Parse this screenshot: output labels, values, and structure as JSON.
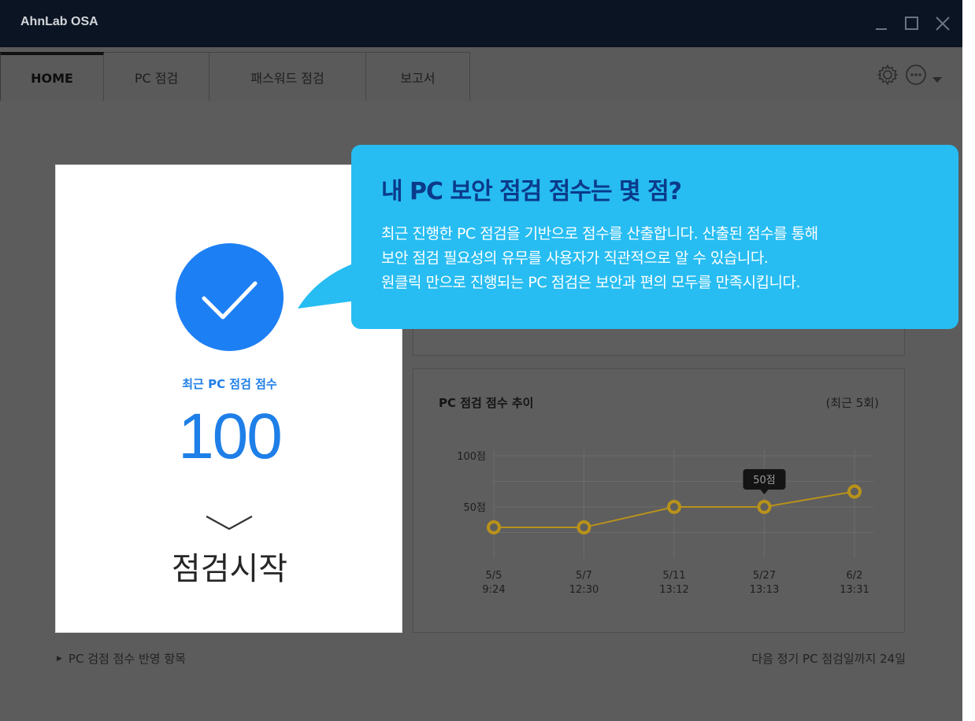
{
  "app": {
    "title": "AhnLab OSA"
  },
  "window_controls": {
    "minimize": "minimize-icon",
    "maximize": "maximize-icon",
    "close": "close-icon"
  },
  "tabs": [
    {
      "label": "HOME",
      "active": true
    },
    {
      "label": "PC 점검",
      "active": false
    },
    {
      "label": "패스워드 점검",
      "active": false
    },
    {
      "label": "보고서",
      "active": false
    }
  ],
  "toolbar_icons": [
    "gear-icon",
    "more-icon",
    "caret-down-icon"
  ],
  "score_card": {
    "label": "최근 PC 점검 점수",
    "value": "100",
    "start_label": "점검시작",
    "accent": "#1d7ff4"
  },
  "trend_panel": {
    "title": "PC 점검 점수 추이",
    "subtitle": "(최근 5회)"
  },
  "chart_data": {
    "type": "line",
    "title": "PC 점검 점수 추이",
    "subtitle": "(최근 5회)",
    "y_tick_labels": [
      "100점",
      "50점"
    ],
    "ylim": [
      0,
      100
    ],
    "categories": [
      "5/5 9:24",
      "5/7 12:30",
      "5/11 13:12",
      "5/27 13:13",
      "6/2 13:31"
    ],
    "x_tick_lines": [
      [
        "5/5",
        "9:24"
      ],
      [
        "5/7",
        "12:30"
      ],
      [
        "5/11",
        "13:12"
      ],
      [
        "5/27",
        "13:13"
      ],
      [
        "6/2",
        "13:31"
      ]
    ],
    "values": [
      30,
      30,
      50,
      50,
      65
    ],
    "tooltip": {
      "index": 3,
      "text": "50점"
    },
    "grid": true,
    "line_color": "#b8921a"
  },
  "footer": {
    "left_link": "PC 검점 점수 반영 항목",
    "right_text": "다음 정기 PC 점검일까지 24일"
  },
  "callout": {
    "title": "내 PC 보안 점검 점수는 몇 점?",
    "lines": [
      "최근 진행한 PC 점검을 기반으로 점수를 산출합니다. 산출된 점수를 통해",
      "보안 점검 필요성의 유무를 사용자가 직관적으로 알 수 있습니다.",
      "원클릭 만으로 진행되는 PC 점검은  보안과 편의 모두를 만족시킵니다."
    ],
    "background": "#27bdf2",
    "title_color": "#0b3a8a"
  }
}
